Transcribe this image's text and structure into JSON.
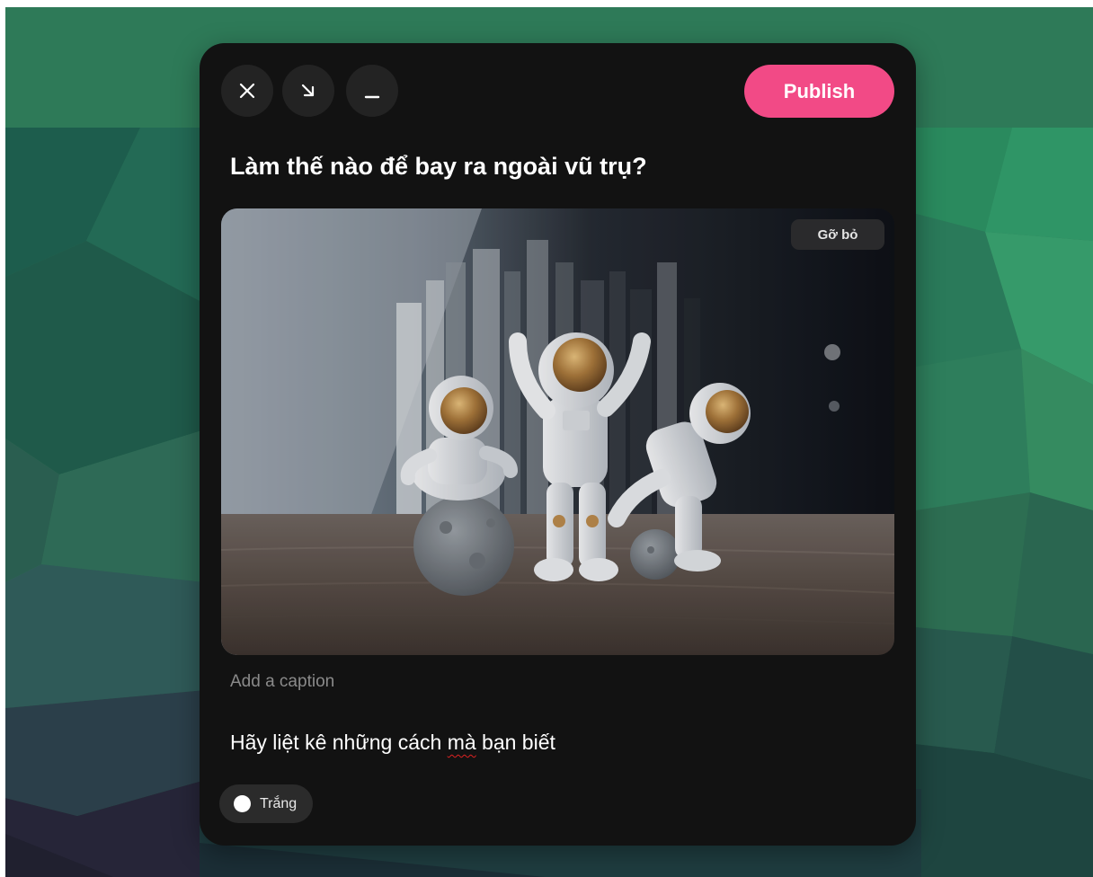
{
  "toolbar": {
    "close_icon": "close-icon",
    "collapse_icon": "arrow-down-right-icon",
    "minimize_icon": "minimize-icon",
    "publish_label": "Publish"
  },
  "post": {
    "title": "Làm thế nào để bay ra ngoài vũ trụ?",
    "image": {
      "remove_label": "Gỡ bỏ",
      "subject": "astronaut-figurines-photo"
    },
    "caption_placeholder": "Add a caption",
    "body_before": "Hãy liệt kê những cách ",
    "body_flagged": "mà",
    "body_after": " bạn biết"
  },
  "theme_chip": {
    "label": "Trắng",
    "swatch_color": "#ffffff"
  },
  "colors": {
    "accent": "#f24a86",
    "panel": "#121212",
    "button": "#232323"
  }
}
